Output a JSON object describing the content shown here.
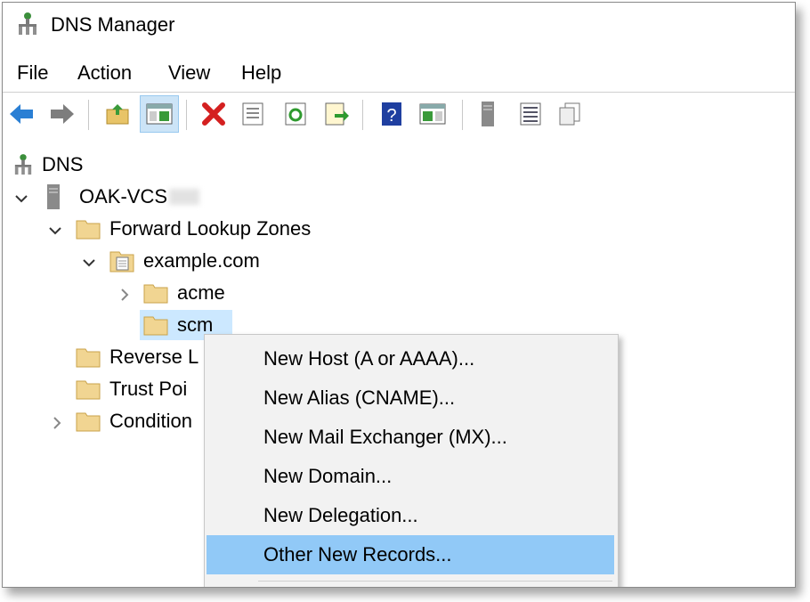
{
  "window": {
    "title": "DNS Manager"
  },
  "menu": [
    "File",
    "Action",
    "View",
    "Help"
  ],
  "toolbar": {
    "buttons": [
      "back-icon",
      "forward-icon",
      "up-folder-icon",
      "show-hide-tree-icon",
      "delete-icon",
      "properties-icon",
      "refresh-icon",
      "export-list-icon",
      "help-icon",
      "show-hide-action-pane-icon",
      "server-icon",
      "list-icon",
      "copy-icon"
    ]
  },
  "tree": {
    "root": "DNS",
    "server": "OAK-VCS",
    "forward_zones": "Forward Lookup Zones",
    "zone": "example.com",
    "sub1": "acme",
    "sub2": "scm",
    "reverse": "Reverse L",
    "trust": "Trust Poi",
    "conditional": "Condition"
  },
  "context_menu": {
    "items": [
      "New Host (A or AAAA)...",
      "New Alias (CNAME)...",
      "New Mail Exchanger (MX)...",
      "New Domain...",
      "New Delegation...",
      "Other New Records..."
    ],
    "highlighted_index": 5
  },
  "colors": {
    "selection": "#cce8ff",
    "menu_highlight": "#91c9f7",
    "menu_bg": "#f2f2f2"
  }
}
